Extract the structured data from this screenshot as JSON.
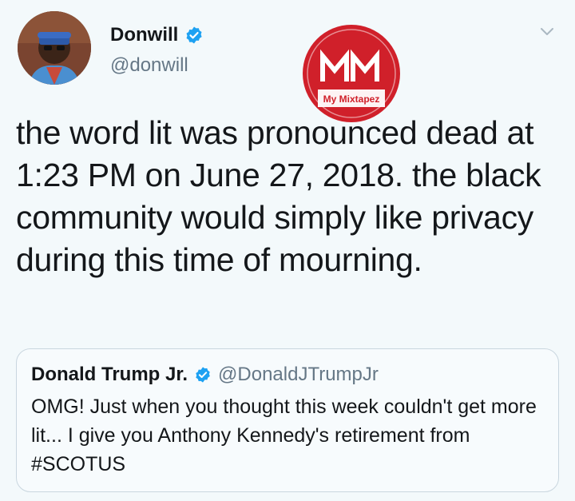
{
  "tweet": {
    "author_name": "Donwill",
    "author_handle": "@donwill",
    "text": "the word lit was pronounced dead at 1:23 PM on June 27, 2018. the black community would simply like privacy during this time of mourning."
  },
  "watermark": {
    "logo_letters": "MM",
    "brand": "My Mixtapez",
    "color": "#d0202a"
  },
  "quote": {
    "author_name": "Donald Trump Jr.",
    "author_handle": "@DonaldJTrumpJr",
    "text": "OMG! Just when you thought this week couldn't get more lit... I give you Anthony Kennedy's retirement from #SCOTUS"
  },
  "colors": {
    "verified": "#1da1f2",
    "secondary_text": "#657786",
    "border": "#c9d6df"
  },
  "icons": {
    "verified": "verified-badge-icon",
    "menu": "chevron-down-icon"
  }
}
